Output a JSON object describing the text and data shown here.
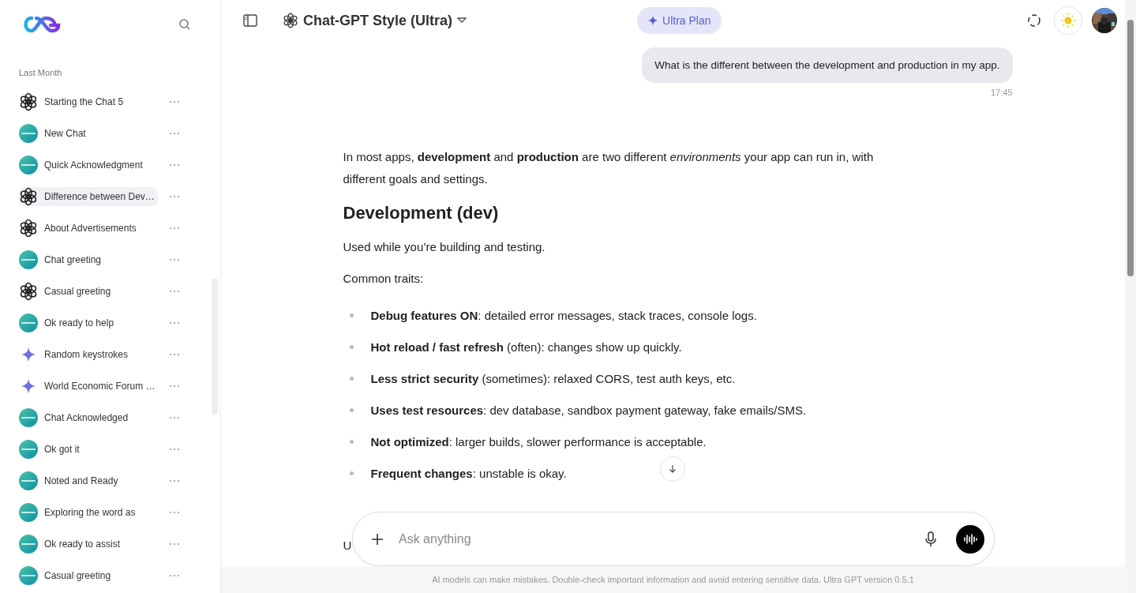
{
  "sidebar": {
    "section_label": "Last Month",
    "items": [
      {
        "title": "Starting the Chat 5",
        "kind": "gpt",
        "selected": false
      },
      {
        "title": "New Chat",
        "kind": "mini",
        "selected": false
      },
      {
        "title": "Quick Acknowledgment",
        "kind": "mini",
        "selected": false
      },
      {
        "title": "Difference between Dev…",
        "kind": "gpt",
        "selected": true
      },
      {
        "title": "About Advertisements",
        "kind": "gpt",
        "selected": false
      },
      {
        "title": "Chat greeting",
        "kind": "mini",
        "selected": false
      },
      {
        "title": "Casual greeting",
        "kind": "gpt",
        "selected": false
      },
      {
        "title": "Ok ready to help",
        "kind": "mini",
        "selected": false
      },
      {
        "title": "Random keystrokes",
        "kind": "sparkle",
        "selected": false
      },
      {
        "title": "World Economic Forum …",
        "kind": "sparkle",
        "selected": false
      },
      {
        "title": "Chat Acknowledged",
        "kind": "mini",
        "selected": false
      },
      {
        "title": "Ok got it",
        "kind": "mini",
        "selected": false
      },
      {
        "title": "Noted and Ready",
        "kind": "mini",
        "selected": false
      },
      {
        "title": "Exploring the word as",
        "kind": "mini",
        "selected": false
      },
      {
        "title": "Ok ready to assist",
        "kind": "mini",
        "selected": false
      },
      {
        "title": "Casual greeting",
        "kind": "mini",
        "selected": false
      }
    ]
  },
  "header": {
    "model": "Chat-GPT Style (Ultra)",
    "plan": "Ultra Plan"
  },
  "user_message": {
    "text": "What is the different between the development and production in my app.",
    "time": "17:45"
  },
  "response": [
    {
      "kind": "paragraph",
      "text": "In most apps, **development** and **production** are two different *environments* your app can run in, with different goals and settings."
    },
    {
      "kind": "heading",
      "text": "Development (dev)"
    },
    {
      "kind": "paragraph",
      "text": "Used while you’re building and testing."
    },
    {
      "kind": "paragraph",
      "text": "Common traits:"
    },
    {
      "kind": "bullet",
      "text": "**Debug features ON**: detailed error messages, stack traces, console logs."
    },
    {
      "kind": "bullet",
      "text": "**Hot reload / fast refresh** (often): changes show up quickly."
    },
    {
      "kind": "bullet",
      "text": "**Less strict security** (sometimes): relaxed CORS, test auth keys, etc."
    },
    {
      "kind": "bullet",
      "text": "**Uses test resources**: dev database, sandbox payment gateway, fake emails/SMS."
    },
    {
      "kind": "bullet",
      "text": "**Not optimized**: larger builds, slower performance is acceptable."
    },
    {
      "kind": "bullet",
      "text": "**Frequent changes**: unstable is okay."
    },
    {
      "kind": "paragraph",
      "text": "U"
    }
  ],
  "composer": {
    "placeholder": "Ask anything"
  },
  "footer": "AI models can make mistakes. Double-check important information and avoid entering sensitive data. Ultra GPT version 0.5.1"
}
